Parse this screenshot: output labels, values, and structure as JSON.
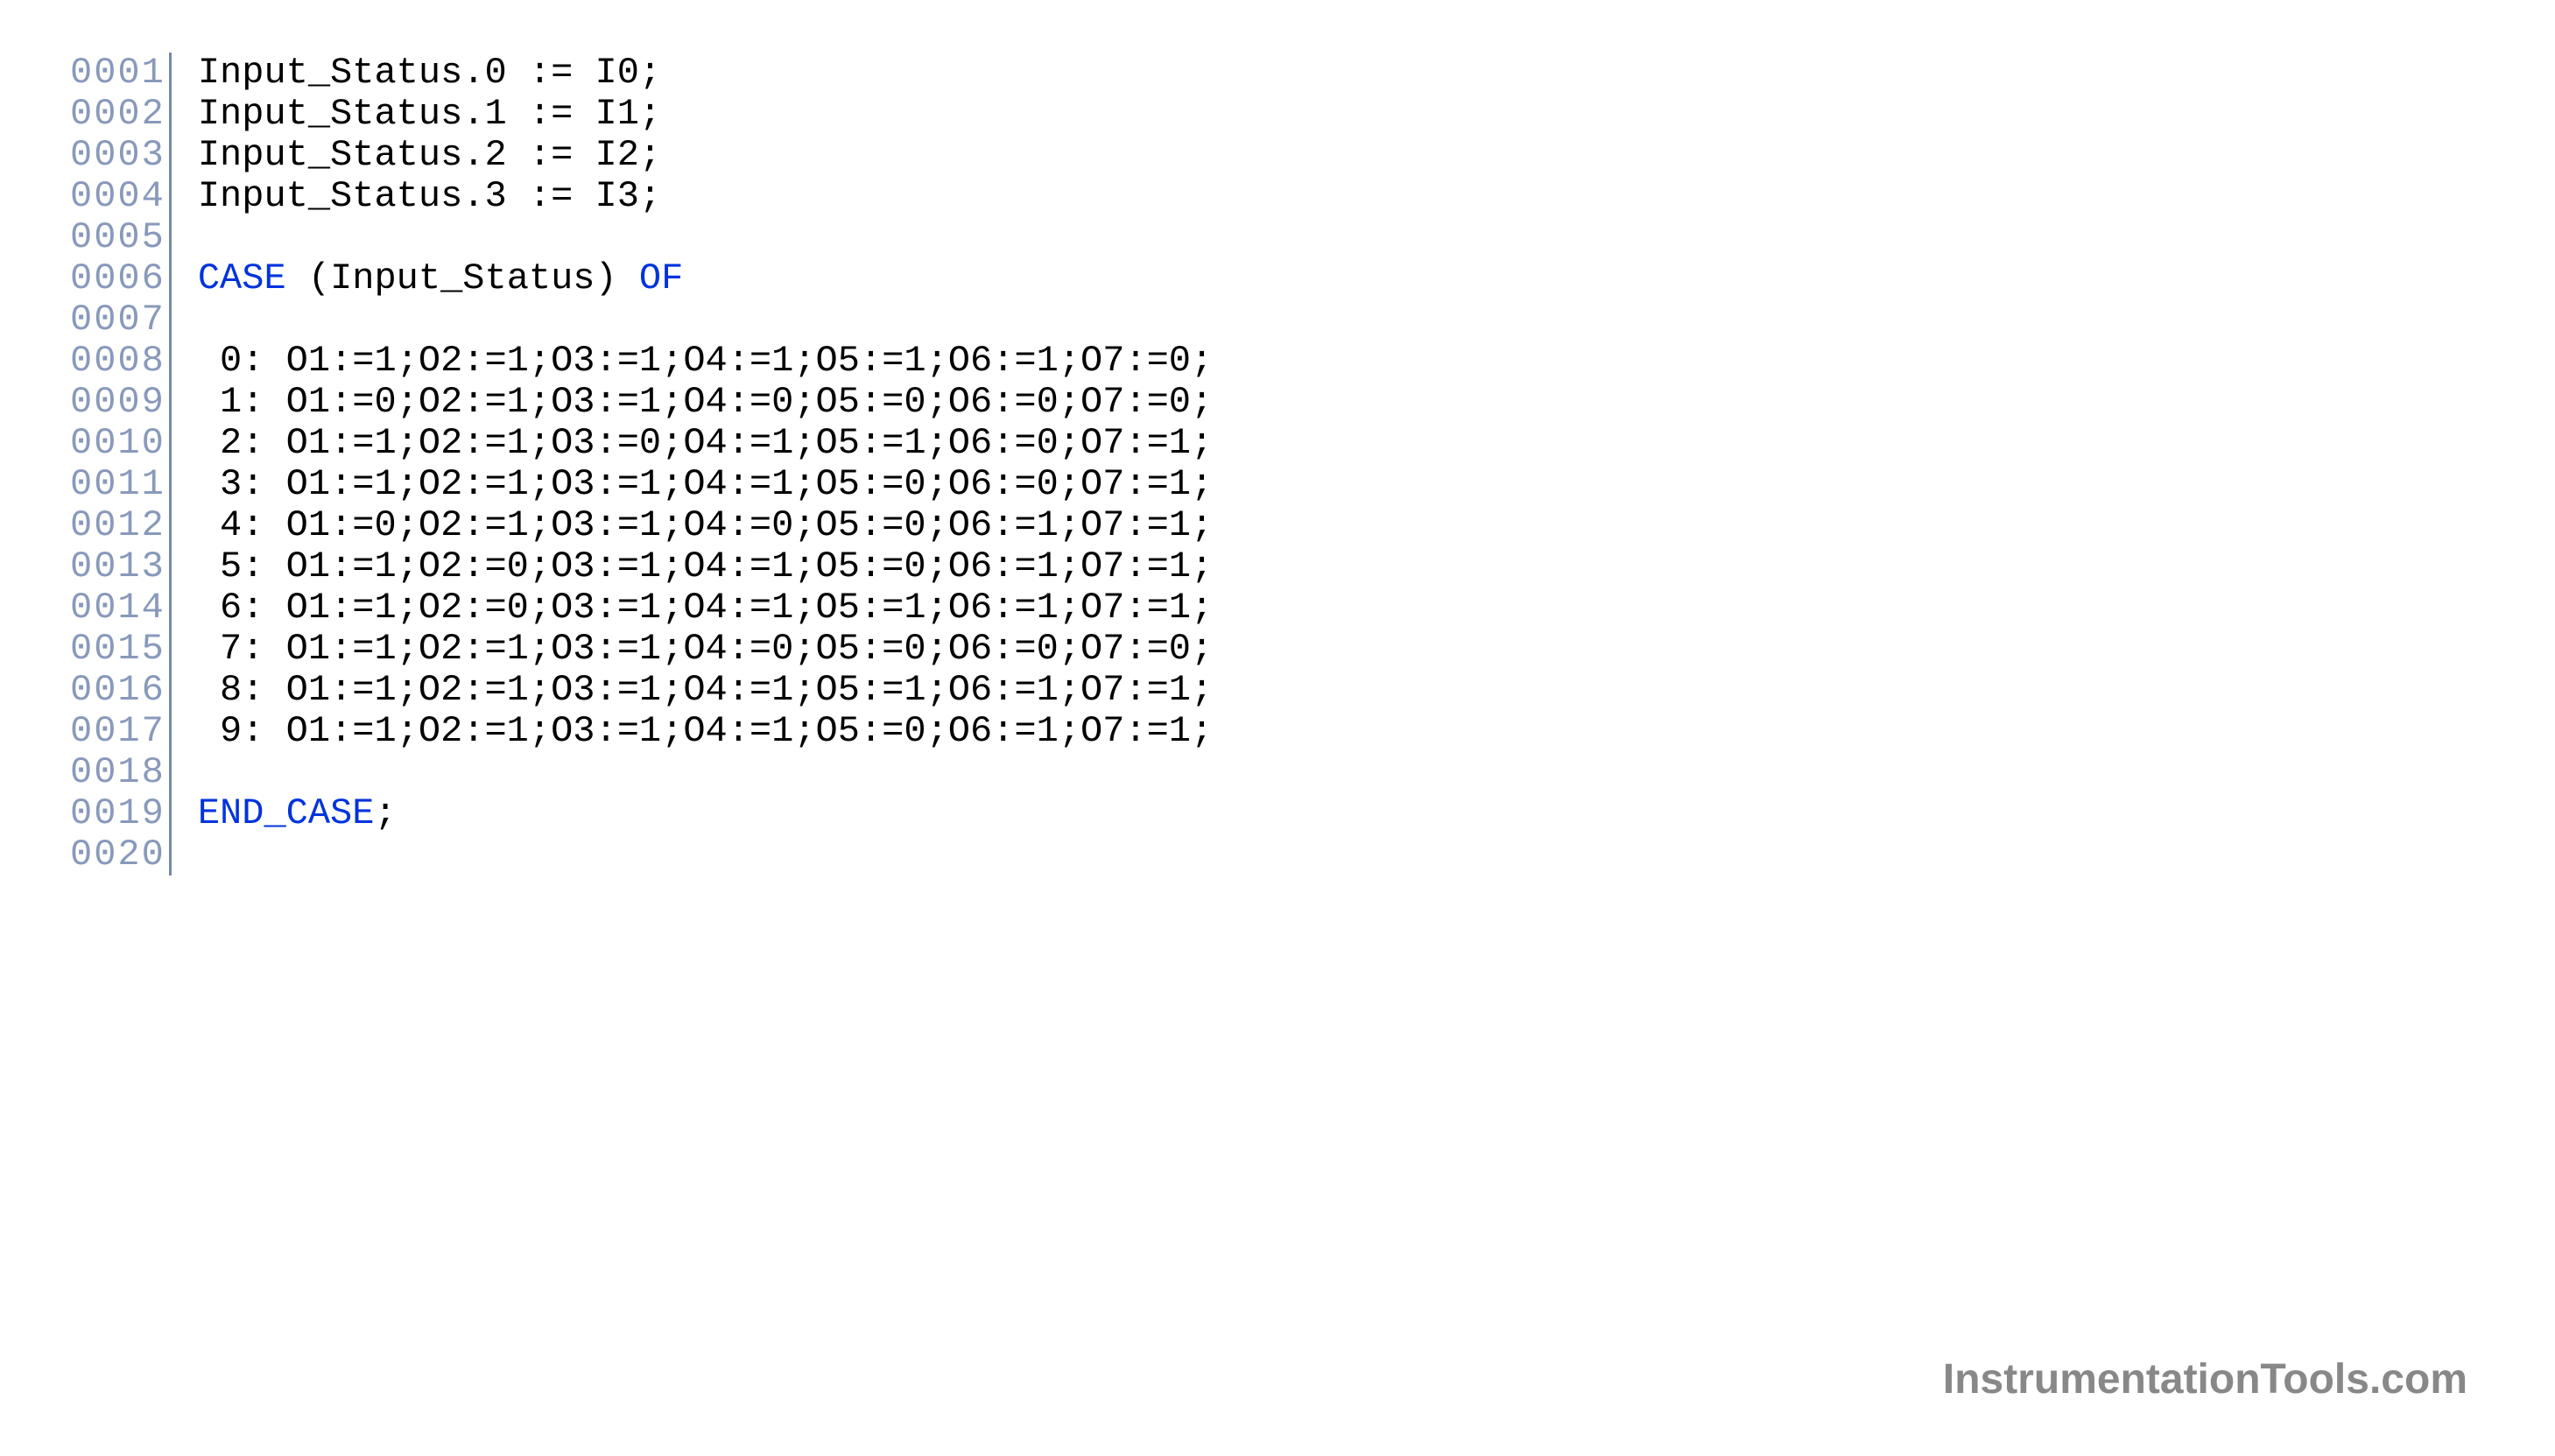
{
  "lines": [
    {
      "num": "0001",
      "parts": [
        {
          "text": "Input_Status.0 := I0;",
          "type": "plain"
        }
      ]
    },
    {
      "num": "0002",
      "parts": [
        {
          "text": "Input_Status.1 := I1;",
          "type": "plain"
        }
      ]
    },
    {
      "num": "0003",
      "parts": [
        {
          "text": "Input_Status.2 := I2;",
          "type": "plain"
        }
      ]
    },
    {
      "num": "0004",
      "parts": [
        {
          "text": "Input_Status.3 := I3;",
          "type": "plain"
        }
      ]
    },
    {
      "num": "0005",
      "parts": []
    },
    {
      "num": "0006",
      "parts": [
        {
          "text": "CASE",
          "type": "keyword"
        },
        {
          "text": " (Input_Status) ",
          "type": "plain"
        },
        {
          "text": "OF",
          "type": "keyword"
        }
      ]
    },
    {
      "num": "0007",
      "parts": []
    },
    {
      "num": "0008",
      "parts": [
        {
          "text": " 0: O1:=1;O2:=1;O3:=1;O4:=1;O5:=1;O6:=1;O7:=0;",
          "type": "plain"
        }
      ]
    },
    {
      "num": "0009",
      "parts": [
        {
          "text": " 1: O1:=0;O2:=1;O3:=1;O4:=0;O5:=0;O6:=0;O7:=0;",
          "type": "plain"
        }
      ]
    },
    {
      "num": "0010",
      "parts": [
        {
          "text": " 2: O1:=1;O2:=1;O3:=0;O4:=1;O5:=1;O6:=0;O7:=1;",
          "type": "plain"
        }
      ]
    },
    {
      "num": "0011",
      "parts": [
        {
          "text": " 3: O1:=1;O2:=1;O3:=1;O4:=1;O5:=0;O6:=0;O7:=1;",
          "type": "plain"
        }
      ]
    },
    {
      "num": "0012",
      "parts": [
        {
          "text": " 4: O1:=0;O2:=1;O3:=1;O4:=0;O5:=0;O6:=1;O7:=1;",
          "type": "plain"
        }
      ]
    },
    {
      "num": "0013",
      "parts": [
        {
          "text": " 5: O1:=1;O2:=0;O3:=1;O4:=1;O5:=0;O6:=1;O7:=1;",
          "type": "plain"
        }
      ]
    },
    {
      "num": "0014",
      "parts": [
        {
          "text": " 6: O1:=1;O2:=0;O3:=1;O4:=1;O5:=1;O6:=1;O7:=1;",
          "type": "plain"
        }
      ]
    },
    {
      "num": "0015",
      "parts": [
        {
          "text": " 7: O1:=1;O2:=1;O3:=1;O4:=0;O5:=0;O6:=0;O7:=0;",
          "type": "plain"
        }
      ]
    },
    {
      "num": "0016",
      "parts": [
        {
          "text": " 8: O1:=1;O2:=1;O3:=1;O4:=1;O5:=1;O6:=1;O7:=1;",
          "type": "plain"
        }
      ]
    },
    {
      "num": "0017",
      "parts": [
        {
          "text": " 9: O1:=1;O2:=1;O3:=1;O4:=1;O5:=0;O6:=1;O7:=1;",
          "type": "plain"
        }
      ]
    },
    {
      "num": "0018",
      "parts": []
    },
    {
      "num": "0019",
      "parts": [
        {
          "text": "END_CASE",
          "type": "keyword"
        },
        {
          "text": ";",
          "type": "plain"
        }
      ]
    },
    {
      "num": "0020",
      "parts": []
    }
  ],
  "watermark": "InstrumentationTools.com"
}
